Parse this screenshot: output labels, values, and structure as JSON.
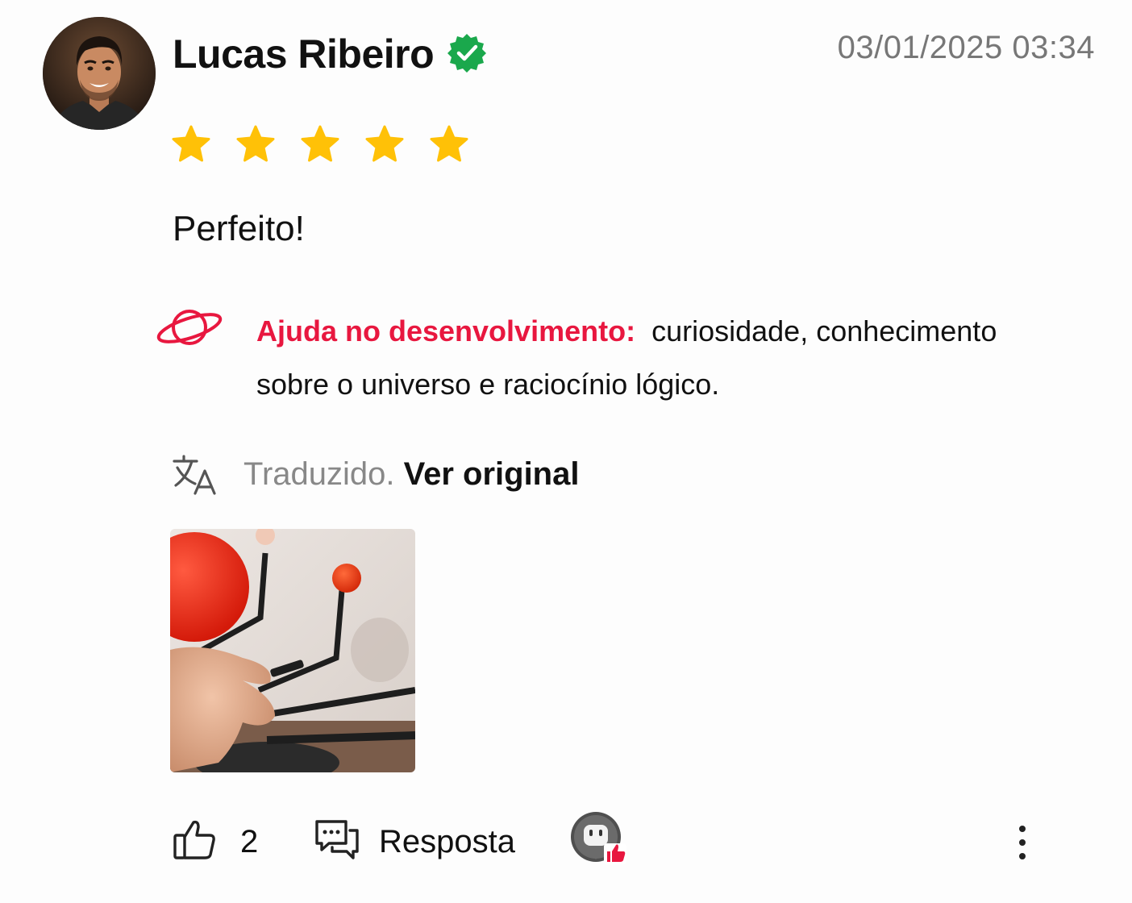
{
  "review": {
    "author": {
      "name": "Lucas Ribeiro",
      "verified": true,
      "avatar_icon": "user-avatar-photo"
    },
    "timestamp": "03/01/2025 03:34",
    "rating": 5,
    "rating_max": 5,
    "text": "Perfeito!",
    "benefit": {
      "icon": "planet-icon",
      "label": "Ajuda no desenvolvimento:",
      "value": "curiosidade, conhecimento sobre o universo e raciocínio lógico."
    },
    "translation": {
      "icon": "translate-icon",
      "status": "Traduzido.",
      "action": "Ver original"
    },
    "photos": [
      {
        "icon": "review-photo-solar-system-model"
      }
    ],
    "actions": {
      "like_icon": "thumbs-up-icon",
      "like_count": "2",
      "reply_icon": "chat-bubbles-icon",
      "reply_label": "Resposta",
      "bot_badge_icon": "robot-like-badge-icon",
      "more_icon": "more-vertical-icon"
    }
  },
  "colors": {
    "accent_red": "#e8173f",
    "star": "#ffc107",
    "verified_green": "#1aa84c",
    "muted_text": "#777777"
  }
}
